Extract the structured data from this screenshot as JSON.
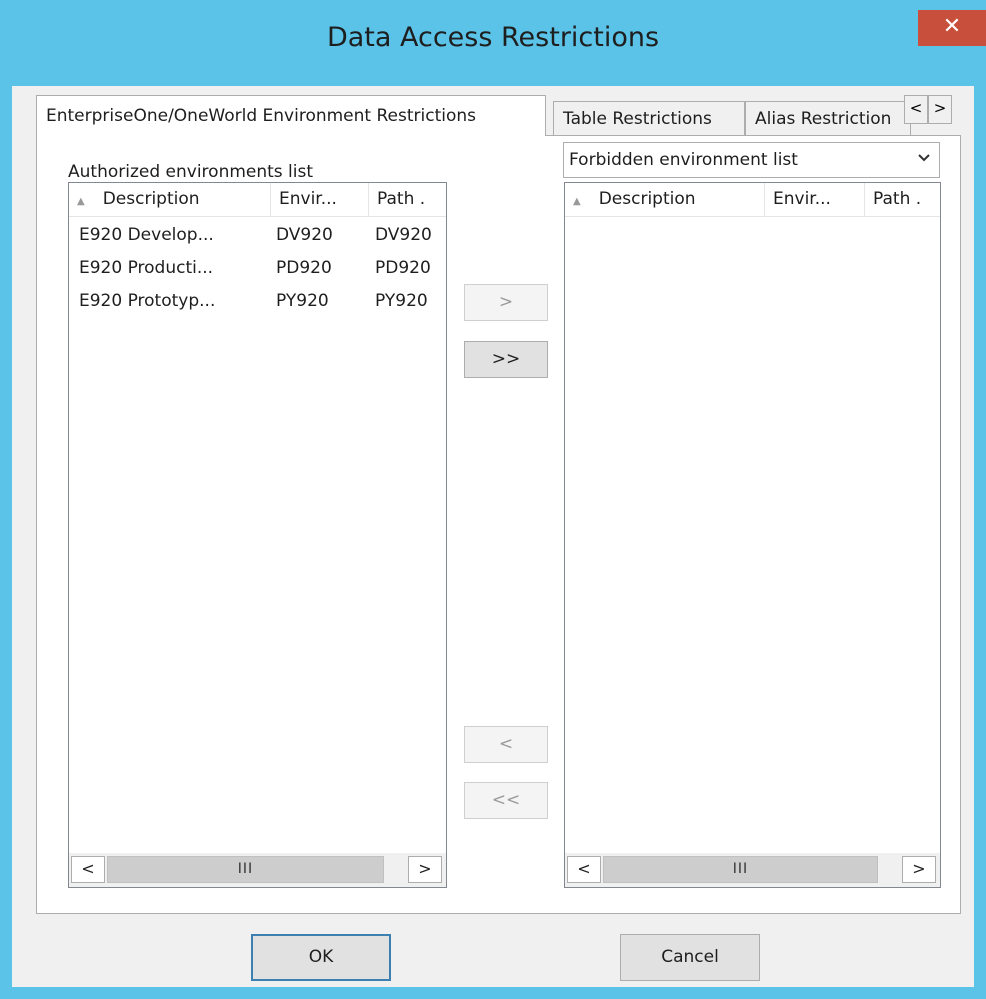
{
  "window": {
    "title": "Data Access Restrictions"
  },
  "tabs": [
    {
      "label": "EnterpriseOne/OneWorld Environment Restrictions",
      "active": true
    },
    {
      "label": "Table Restrictions",
      "active": false
    },
    {
      "label": "Alias Restriction",
      "active": false
    }
  ],
  "tab_scroll": {
    "left": "<",
    "right": ">"
  },
  "authorized": {
    "label": "Authorized environments list",
    "columns": [
      "Description",
      "Envir...",
      "Path ."
    ],
    "rows": [
      [
        "E920 Develop...",
        "DV920",
        "DV920"
      ],
      [
        "E920 Producti...",
        "PD920",
        "PD920"
      ],
      [
        "E920 Prototyp...",
        "PY920",
        "PY920"
      ]
    ],
    "scroll_thumb": "III"
  },
  "forbidden": {
    "selector_value": "Forbidden environment list",
    "columns": [
      "Description",
      "Envir...",
      "Path ."
    ],
    "rows": [],
    "scroll_thumb": "III"
  },
  "move_buttons": {
    "add_one": ">",
    "add_all": ">>",
    "remove_one": "<",
    "remove_all": "<<"
  },
  "dialog_buttons": {
    "ok": "OK",
    "cancel": "Cancel"
  },
  "colors": {
    "title_bar": "#5bc3e8",
    "close_button": "#c74f3c",
    "dialog_bg": "#f0f0f0"
  }
}
